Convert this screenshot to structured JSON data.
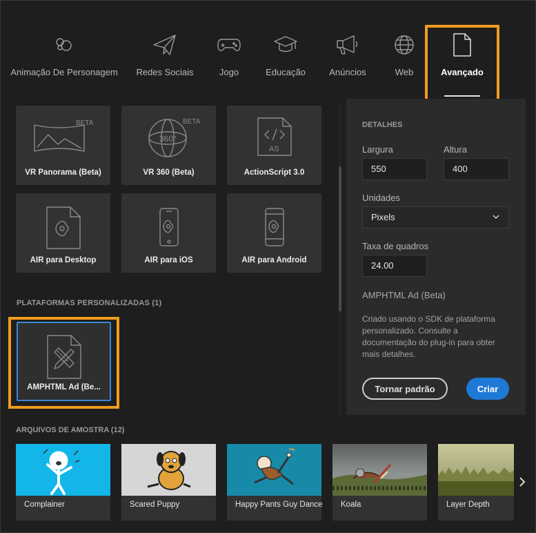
{
  "tabs": [
    {
      "label": "Animação De Personagem",
      "icon": "character-animation-icon"
    },
    {
      "label": "Redes Sociais",
      "icon": "paper-plane-icon"
    },
    {
      "label": "Jogo",
      "icon": "gamepad-icon"
    },
    {
      "label": "Educação",
      "icon": "graduation-cap-icon"
    },
    {
      "label": "Anúncios",
      "icon": "megaphone-icon"
    },
    {
      "label": "Web",
      "icon": "globe-icon"
    },
    {
      "label": "Avançado",
      "icon": "document-icon",
      "active": true
    }
  ],
  "presets": [
    {
      "label": "VR Panorama (Beta)",
      "badge": "BETA",
      "icon": "vr-panorama-icon"
    },
    {
      "label": "VR 360 (Beta)",
      "badge": "BETA",
      "icon_text": "360°",
      "icon": "vr-360-icon"
    },
    {
      "label": "ActionScript 3.0",
      "icon_text": "AS",
      "icon": "actionscript-file-icon"
    },
    {
      "label": "AIR para Desktop",
      "icon": "air-desktop-icon"
    },
    {
      "label": "AIR para iOS",
      "icon": "air-ios-icon"
    },
    {
      "label": "AIR para Android",
      "icon": "air-android-icon"
    }
  ],
  "custom_platforms": {
    "heading": "PLATAFORMAS PERSONALIZADAS (1)",
    "items": [
      {
        "label": "AMPHTML Ad (Be...",
        "icon": "amphtml-ruler-pencil-icon",
        "selected": true
      }
    ]
  },
  "details": {
    "heading": "DETALHES",
    "width_label": "Largura",
    "width_value": "550",
    "height_label": "Altura",
    "height_value": "400",
    "units_label": "Unidades",
    "units_value": "Pixels",
    "framerate_label": "Taxa de quadros",
    "framerate_value": "24.00",
    "preset_name": "AMPHTML Ad (Beta)",
    "description": "Criado usando o SDK de plataforma personalizado. Consulte a documentação do plug-in para obter mais detalhes.",
    "make_default_label": "Tornar padrão",
    "create_label": "Criar"
  },
  "samples": {
    "heading": "ARQUIVOS DE AMOSTRA (12)",
    "items": [
      {
        "label": "Complainer"
      },
      {
        "label": "Scared Puppy"
      },
      {
        "label": "Happy Pants Guy Dance"
      },
      {
        "label": "Koala"
      },
      {
        "label": "Layer Depth"
      }
    ]
  },
  "colors": {
    "highlight": "#f39c1e",
    "accent_blue": "#1e79d6",
    "selection_border": "#3b87d4",
    "background": "#1e1e1e",
    "card": "#323232"
  }
}
